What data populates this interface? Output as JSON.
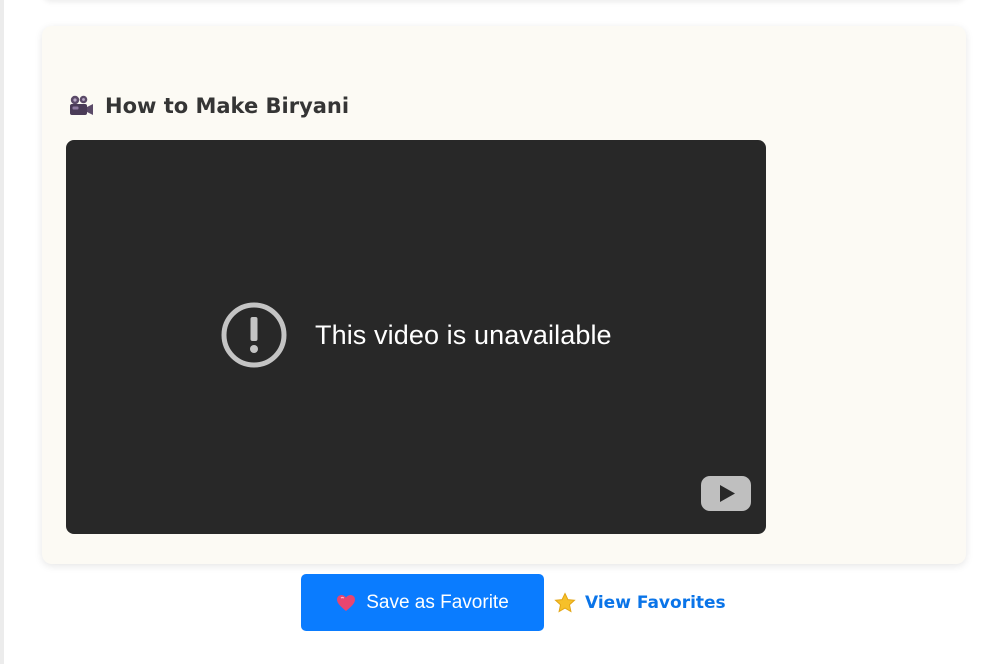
{
  "recipe_video": {
    "title": "How to Make Biryani",
    "title_icon": "movie-camera-icon",
    "player": {
      "message": "This video is unavailable",
      "status_icon": "exclamation-circle-icon",
      "brand_icon": "youtube-icon"
    }
  },
  "actions": {
    "save_label": "Save as Favorite",
    "save_icon": "heart-icon",
    "view_label": "View Favorites",
    "view_icon": "star-icon"
  },
  "colors": {
    "card_background": "#fcfaf4",
    "player_background": "#282828",
    "primary_button": "#0a7cff",
    "link": "#0a74e8",
    "title_text": "#353535",
    "heart": "#e8456f",
    "star": "#f6c02a"
  }
}
